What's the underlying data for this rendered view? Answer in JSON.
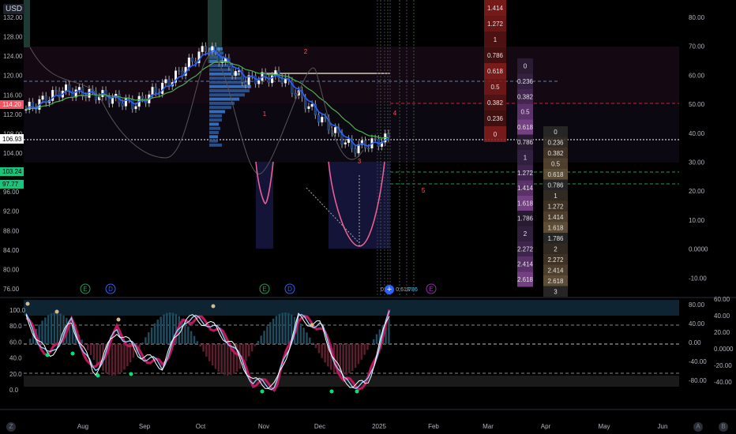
{
  "header": {
    "currency": "USD"
  },
  "price_axis": {
    "labels": [
      "132.00",
      "128.00",
      "124.00",
      "120.00",
      "116.00",
      "112.00",
      "108.00",
      "104.00",
      "100.00",
      "96.00",
      "92.00",
      "88.00",
      "84.00",
      "80.00",
      "76.00"
    ],
    "last_price_label": "106.93",
    "red_tag": "114.20",
    "green_tags": [
      "103.24",
      "97.77"
    ]
  },
  "right_axis_upper": [
    "80.00",
    "70.00",
    "60.00",
    "50.00",
    "40.00",
    "30.00",
    "20.00",
    "10.00",
    "0.0000",
    "-10.00"
  ],
  "lower_pane": {
    "left_axis": [
      "100.0",
      "80.0",
      "60.0",
      "40.0",
      "20.0",
      "0.0"
    ],
    "right_axis_a": [
      "80.00",
      "40.00",
      "0.00",
      "-40.00",
      "-80.00"
    ],
    "right_axis_b": [
      "60.00",
      "40.00",
      "20.00",
      "0.0000",
      "-20.00",
      "-40.00"
    ]
  },
  "time_axis": [
    "Aug",
    "Sep",
    "Oct",
    "Nov",
    "Dec",
    "2025",
    "Feb",
    "Mar",
    "Apr",
    "May",
    "Jun"
  ],
  "event_markers": [
    "E",
    "D",
    "E",
    "D",
    "E"
  ],
  "wave_labels": [
    "1",
    "2",
    "3",
    "4",
    "5"
  ],
  "fib_columns": {
    "col1": [
      "1.414",
      "1.272",
      "1",
      "0.786",
      "0.618",
      "0.5",
      "0.382",
      "0.236",
      "0"
    ],
    "col2": [
      "0",
      "0.236",
      "0.382",
      "0.5",
      "0.618",
      "0.786",
      "1",
      "1.272",
      "1.414",
      "1.618",
      "1.786",
      "2",
      "2.272",
      "2.414",
      "2.618"
    ],
    "col3": [
      "0",
      "0.236",
      "0.382",
      "0.5",
      "0.618",
      "0.786",
      "1",
      "1.272",
      "1.414",
      "1.618",
      "1.786",
      "2",
      "2.272",
      "2.414",
      "2.618",
      "3"
    ]
  },
  "bottom_fib_text": [
    "0",
    "0.618",
    "786"
  ],
  "icons": {
    "settings": "gear-icon",
    "zoom": "auto-scale-icon"
  },
  "bottom_letters": [
    "A",
    "B",
    "Z"
  ],
  "colors": {
    "bg": "#000000",
    "candle_up": "#ffffff",
    "candle_down": "#2a2e39",
    "ema_green": "#26a69a",
    "ema_blue": "#2962ff",
    "red": "#f23645",
    "pink": "#f06292",
    "green_tag": "#1bc47d",
    "red_tag": "#f7525f"
  },
  "chart_data": {
    "type": "line",
    "title": "",
    "x": [
      "Aug",
      "Sep",
      "Oct",
      "Nov",
      "Dec",
      "2025"
    ],
    "series": [
      {
        "values": [
          113,
          117,
          116,
          114,
          119,
          126,
          119,
          120,
          112,
          105,
          107
        ]
      }
    ],
    "ylim": [
      74,
      134
    ],
    "last_price": 106.93,
    "oscillator": {
      "ylim": [
        -5,
        105
      ],
      "values": [
        90,
        40,
        85,
        20,
        75,
        45,
        30,
        90,
        85,
        60,
        10,
        5,
        90,
        80,
        10,
        5,
        95
      ]
    }
  }
}
